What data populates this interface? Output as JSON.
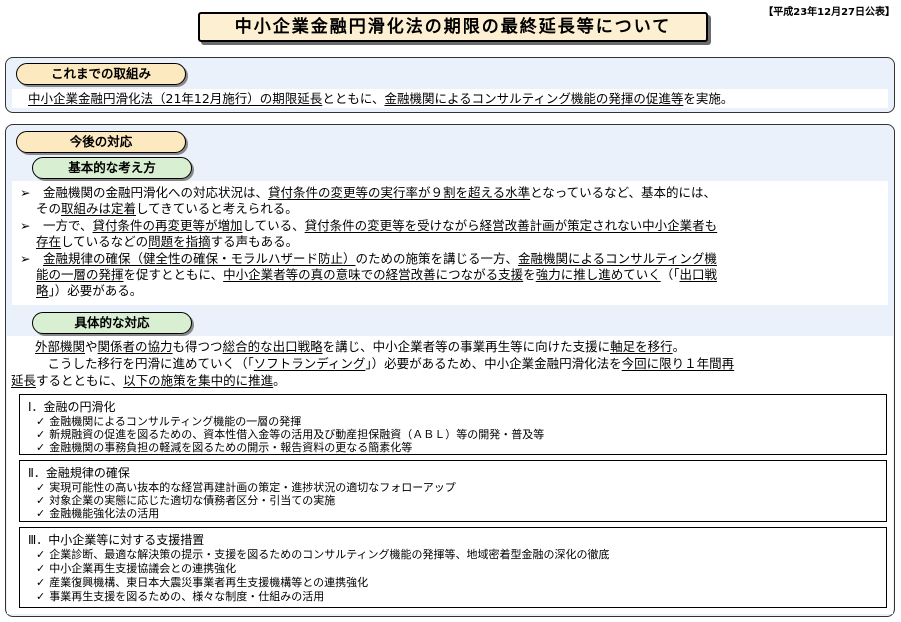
{
  "header": {
    "date": "【平成23年12月27日公表】",
    "title": "中小企業金融円滑化法の期限の最終延長等について"
  },
  "past": {
    "label": "これまでの取組み",
    "parts": [
      {
        "t": "中小企業金融円滑化法（21年12月施行）の期限延長",
        "u": true
      },
      {
        "t": "とともに、",
        "u": false
      },
      {
        "t": "金融機関によるコンサルティング機能の発揮の促進等",
        "u": true
      },
      {
        "t": "を実施。",
        "u": false
      }
    ]
  },
  "future": {
    "label": "今後の対応",
    "basic": {
      "label": "基本的な考え方",
      "lines": [
        [
          {
            "t": "➢　金融機関の金融円滑化への対応状況は、",
            "u": false
          },
          {
            "t": "貸付条件の変更等の実行率が９割を超える水準",
            "u": true
          },
          {
            "t": "となっているなど、基本的には、",
            "u": false
          }
        ],
        [
          {
            "t": "その",
            "u": false
          },
          {
            "t": "取組みは定着",
            "u": true
          },
          {
            "t": "してきていると考えられる。",
            "u": false
          }
        ],
        [
          {
            "t": "➢　一方で、",
            "u": false
          },
          {
            "t": "貸付条件の再変更等が増加",
            "u": true
          },
          {
            "t": "している、",
            "u": false
          },
          {
            "t": "貸付条件の変更等を受けながら経営改善計画が策定されない中小企業者も",
            "u": true
          }
        ],
        [
          {
            "t": "存在",
            "u": true
          },
          {
            "t": "しているなどの",
            "u": false
          },
          {
            "t": "問題を指摘",
            "u": true
          },
          {
            "t": "する声もある。",
            "u": false
          }
        ],
        [
          {
            "t": "➢　",
            "u": false
          },
          {
            "t": "金融規律の確保（健全性の確保・モラルハザード防止）",
            "u": true
          },
          {
            "t": "のための施策を講じる一方、",
            "u": false
          },
          {
            "t": "金融機関によるコンサルティング機",
            "u": true
          }
        ],
        [
          {
            "t": "能の一層の発揮",
            "u": true
          },
          {
            "t": "を促すとともに、",
            "u": false
          },
          {
            "t": "中小企業者等の真の意味での経営改善につながる支援",
            "u": true
          },
          {
            "t": "を",
            "u": false
          },
          {
            "t": "強力に推し進めていく",
            "u": true
          },
          {
            "t": "（「",
            "u": false
          },
          {
            "t": "出口戦",
            "u": true
          }
        ],
        [
          {
            "t": "略",
            "u": true
          },
          {
            "t": "」）必要がある。",
            "u": false
          }
        ]
      ]
    },
    "specific": {
      "label": "具体的な対応",
      "lines": [
        [
          {
            "t": "外部機関",
            "u": true
          },
          {
            "t": "や",
            "u": false
          },
          {
            "t": "関係者の協力",
            "u": true
          },
          {
            "t": "も得つつ",
            "u": false
          },
          {
            "t": "総合的な出口戦略",
            "u": true
          },
          {
            "t": "を講じ、中小企業者等の事業再生等に向けた支援に",
            "u": false
          },
          {
            "t": "軸足を移行",
            "u": true
          },
          {
            "t": "。",
            "u": false
          }
        ],
        [
          {
            "t": "　こうした移行を円滑に進めていく（「",
            "u": false
          },
          {
            "t": "ソフトランディング",
            "u": true
          },
          {
            "t": "」）必要があるため、中小企業金融円滑化法を",
            "u": false
          },
          {
            "t": "今回に限り１年間再",
            "u": true
          }
        ],
        [
          {
            "t": "延長",
            "u": true
          },
          {
            "t": "するとともに、",
            "u": false
          },
          {
            "t": "以下の施策を集中的に推進",
            "u": true
          },
          {
            "t": "。",
            "u": false
          }
        ]
      ],
      "measures": [
        {
          "heading": "Ⅰ．金融の円滑化",
          "items": [
            "金融機関によるコンサルティング機能の一層の発揮",
            "新規融資の促進を図るための、資本性借入金等の活用及び動産担保融資（ＡＢＬ）等の開発・普及等",
            "金融機関の事務負担の軽減を図るための開示・報告資料の更なる簡素化等"
          ]
        },
        {
          "heading": "Ⅱ．金融規律の確保",
          "items": [
            "実現可能性の高い抜本的な経営再建計画の策定・進捗状況の適切なフォローアップ",
            "対象企業の実態に応じた適切な債務者区分・引当ての実施",
            "金融機能強化法の活用"
          ]
        },
        {
          "heading": "Ⅲ．中小企業等に対する支援措置",
          "items": [
            "企業診断、最適な解決策の提示・支援を図るためのコンサルティング機能の発揮等、地域密着型金融の深化の徹底",
            "中小企業再生支援協議会との連携強化",
            "産業復興機構、東日本大震災事業者再生支援機構等との連携強化",
            "事業再生支援を図るための、様々な制度・仕組みの活用"
          ]
        }
      ]
    }
  }
}
